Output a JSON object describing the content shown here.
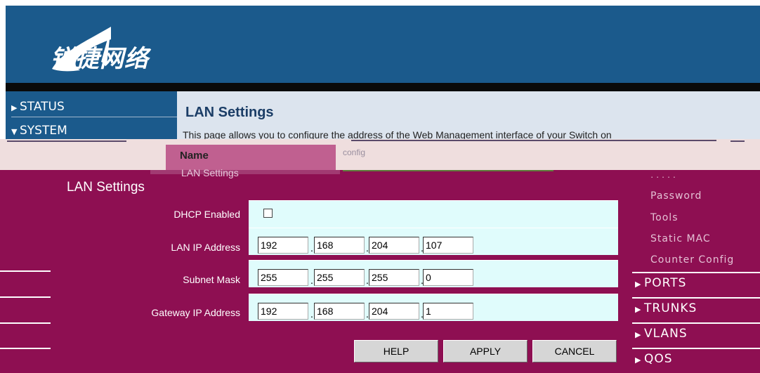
{
  "header": {
    "logo_text": "锐捷网络"
  },
  "nav": {
    "items": [
      {
        "label": "STATUS",
        "icon": "triangle-right-icon"
      },
      {
        "label": "SYSTEM",
        "icon": "triangle-down-icon"
      }
    ],
    "sub_item": "LAN Settings"
  },
  "page": {
    "title": "LAN Settings",
    "description": "This page allows you to configure the address of the Web Management interface of your Switch on",
    "description_cont": "config",
    "column_name": "Name"
  },
  "dialog": {
    "title": "LAN Settings",
    "fields": {
      "dhcp_label": "DHCP Enabled",
      "lan_ip_label": "LAN IP Address",
      "subnet_label": "Subnet Mask",
      "gateway_label": "Gateway IP Address"
    },
    "lan_ip": [
      "192",
      "168",
      "204",
      "107"
    ],
    "subnet": [
      "255",
      "255",
      "255",
      "0"
    ],
    "gateway": [
      "192",
      "168",
      "204",
      "1"
    ],
    "dhcp_checked": false,
    "buttons": {
      "help": "HELP",
      "apply": "APPLY",
      "cancel": "CANCEL"
    }
  },
  "right_menu": {
    "sub_items": [
      "Password",
      "Tools",
      "Static MAC",
      "Counter Config"
    ],
    "items": [
      "PORTS",
      "TRUNKS",
      "VLANS",
      "QOS"
    ]
  },
  "colors": {
    "header_blue": "#1b5a8c",
    "dialog_bg": "#8e0f52",
    "field_bg": "#e0fcfc",
    "button_bg": "#d6d6d6"
  }
}
